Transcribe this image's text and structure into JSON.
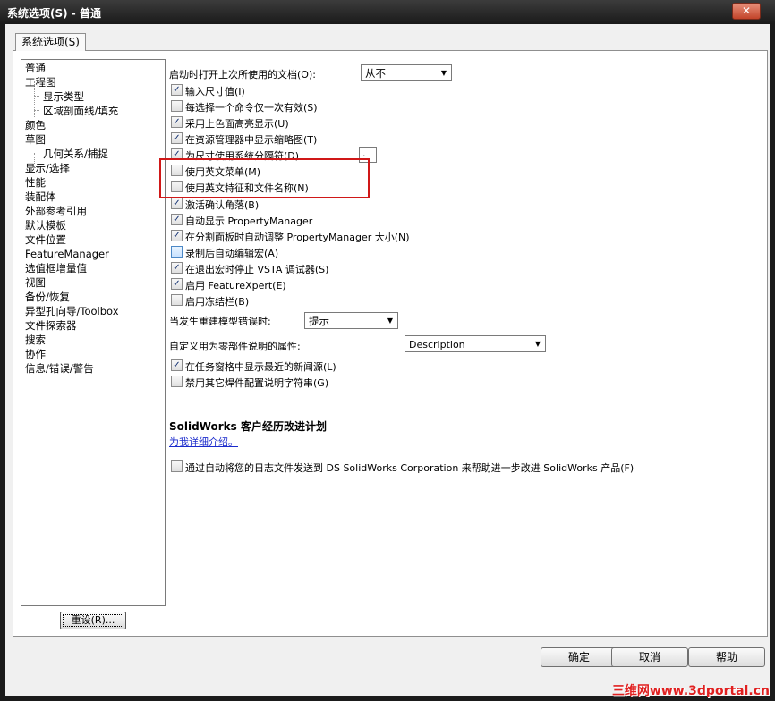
{
  "window": {
    "title": "系统选项(S) - 普通",
    "close_glyph": "✕"
  },
  "tab": {
    "label": "系统选项(S)"
  },
  "tree": {
    "items": [
      {
        "label": "普通",
        "indent": 0
      },
      {
        "label": "工程图",
        "indent": 0
      },
      {
        "label": "显示类型",
        "indent": 1
      },
      {
        "label": "区域剖面线/填充",
        "indent": 1
      },
      {
        "label": "颜色",
        "indent": 0
      },
      {
        "label": "草图",
        "indent": 0
      },
      {
        "label": "几何关系/捕捉",
        "indent": 1
      },
      {
        "label": "显示/选择",
        "indent": 0
      },
      {
        "label": "性能",
        "indent": 0
      },
      {
        "label": "装配体",
        "indent": 0
      },
      {
        "label": "外部参考引用",
        "indent": 0
      },
      {
        "label": "默认模板",
        "indent": 0
      },
      {
        "label": "文件位置",
        "indent": 0
      },
      {
        "label": "FeatureManager",
        "indent": 0
      },
      {
        "label": "选值框增量值",
        "indent": 0
      },
      {
        "label": "视图",
        "indent": 0
      },
      {
        "label": "备份/恢复",
        "indent": 0
      },
      {
        "label": "异型孔向导/Toolbox",
        "indent": 0
      },
      {
        "label": "文件探索器",
        "indent": 0
      },
      {
        "label": "搜索",
        "indent": 0
      },
      {
        "label": "协作",
        "indent": 0
      },
      {
        "label": "信息/错误/警告",
        "indent": 0
      }
    ],
    "reset_label": "重设(R)..."
  },
  "options": {
    "open_docs_label": "启动时打开上次所使用的文档(O):",
    "open_docs_value": "从不",
    "separator_value": ".",
    "checkboxes": [
      {
        "label": "输入尺寸值(I)",
        "checked": true
      },
      {
        "label": "每选择一个命令仅一次有效(S)",
        "checked": false
      },
      {
        "label": "采用上色面高亮显示(U)",
        "checked": true
      },
      {
        "label": "在资源管理器中显示缩略图(T)",
        "checked": true
      },
      {
        "label": "为尺寸使用系统分隔符(D)",
        "checked": true
      },
      {
        "label": "使用英文菜单(M)",
        "checked": false
      },
      {
        "label": "使用英文特征和文件名称(N)",
        "checked": false
      },
      {
        "label": "激活确认角落(B)",
        "checked": true
      },
      {
        "label": "自动显示 PropertyManager",
        "checked": true
      },
      {
        "label": "在分割面板时自动调整 PropertyManager 大小(N)",
        "checked": true
      },
      {
        "label": "录制后自动编辑宏(A)",
        "checked": false
      },
      {
        "label": "在退出宏时停止 VSTA 调试器(S)",
        "checked": true
      },
      {
        "label": "启用 FeatureXpert(E)",
        "checked": true
      },
      {
        "label": "启用冻结栏(B)",
        "checked": false
      }
    ],
    "rebuild_error_label": "当发生重建模型错误时:",
    "rebuild_error_value": "提示",
    "custom_prop_label": "自定义用为零部件说明的属性:",
    "custom_prop_value": "Description",
    "checkboxes2": [
      {
        "label": "在任务窗格中显示最近的新闻源(L)",
        "checked": true
      },
      {
        "label": "禁用其它焊件配置说明字符串(G)",
        "checked": false
      }
    ],
    "program_title": "SolidWorks 客户经历改进计划",
    "program_link": "为我详细介绍。",
    "program_checkbox": {
      "label": "通过自动将您的日志文件发送到 DS SolidWorks Corporation 来帮助进一步改进 SolidWorks 产品(F)",
      "checked": false
    }
  },
  "buttons": {
    "ok": "确定",
    "cancel": "取消",
    "help": "帮助"
  },
  "watermark": "三维网www.3dportal.cn",
  "colors": {
    "highlight_box": "#d01818",
    "link": "#1a2acc"
  }
}
